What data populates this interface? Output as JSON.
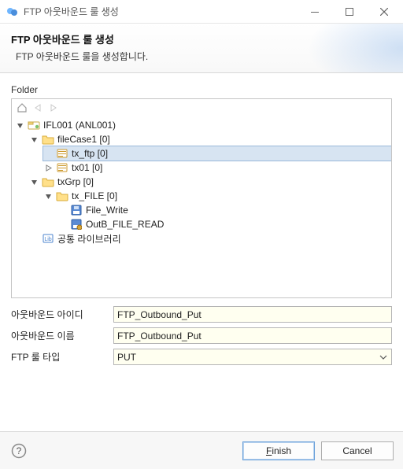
{
  "window": {
    "title": "FTP 아웃바운드 룰 생성"
  },
  "banner": {
    "heading": "FTP 아웃바운드 룰 생성",
    "sub": "FTP 아웃바운드 룰을 생성합니다."
  },
  "folder_label": "Folder",
  "tree": {
    "root": {
      "label": "IFL001  (ANL001)",
      "children": [
        {
          "label": "fileCase1 [0]",
          "children": [
            {
              "label": "tx_ftp [0]",
              "selected": true
            },
            {
              "label": "tx01 [0]"
            }
          ]
        },
        {
          "label": "txGrp [0]",
          "children": [
            {
              "label": "tx_FILE [0]",
              "children": [
                {
                  "label": "File_Write"
                },
                {
                  "label": "OutB_FILE_READ"
                }
              ]
            }
          ]
        },
        {
          "label": "공통 라이브러리"
        }
      ]
    }
  },
  "form": {
    "outbound_id": {
      "label": "아웃바운드 아이디",
      "value": "FTP_Outbound_Put"
    },
    "outbound_name": {
      "label": "아웃바운드 이름",
      "value": "FTP_Outbound_Put"
    },
    "rule_type": {
      "label": "FTP 룰 타입",
      "value": "PUT"
    }
  },
  "buttons": {
    "finish_mn": "F",
    "finish_rest": "inish",
    "cancel": "Cancel"
  }
}
